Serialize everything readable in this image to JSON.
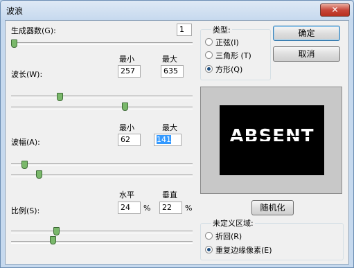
{
  "window": {
    "title": "波浪",
    "close": "✕"
  },
  "generators": {
    "label": "生成器数(G):",
    "value": "1",
    "slider_position": 0.0
  },
  "wavelength": {
    "label": "波长(W):",
    "min_header": "最小",
    "max_header": "最大",
    "min_value": "257",
    "max_value": "635",
    "min_slider_position": 0.26,
    "max_slider_position": 0.63
  },
  "amplitude": {
    "label": "波幅(A):",
    "min_header": "最小",
    "max_header": "最大",
    "min_value": "62",
    "max_value": "141",
    "min_slider_position": 0.06,
    "max_slider_position": 0.14
  },
  "scale": {
    "label": "比例(S):",
    "h_header": "水平",
    "v_header": "垂直",
    "h_value": "24",
    "v_value": "22",
    "percent": "%",
    "h_slider_position": 0.24,
    "v_slider_position": 0.22
  },
  "type_group": {
    "title": "类型:",
    "options": [
      {
        "label": "正弦(I)",
        "selected": false
      },
      {
        "label": "三角形 (T)",
        "selected": false
      },
      {
        "label": "方形(Q)",
        "selected": true
      }
    ]
  },
  "buttons": {
    "ok": "确定",
    "cancel": "取消",
    "randomize": "随机化"
  },
  "preview": {
    "text": "ABSENT"
  },
  "undefined_area": {
    "title": "未定义区域:",
    "options": [
      {
        "label": "折回(R)",
        "selected": false
      },
      {
        "label": "重复边缘像素(E)",
        "selected": true
      }
    ]
  }
}
